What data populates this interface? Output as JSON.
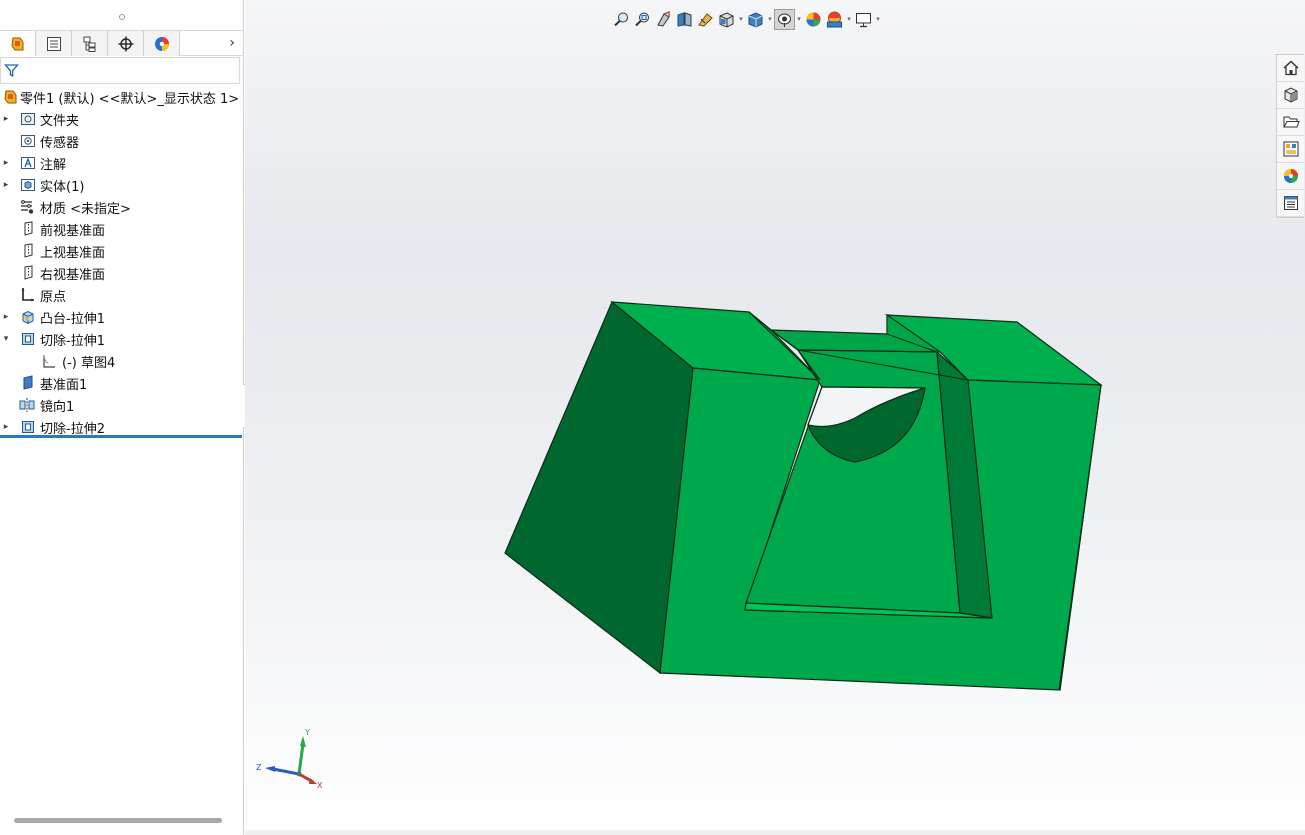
{
  "panel": {
    "tabs": [
      {
        "name": "featuremanager-tab",
        "icon": "featuremanager-icon"
      },
      {
        "name": "propertymanager-tab",
        "icon": "propertymanager-icon"
      },
      {
        "name": "configurationmanager-tab",
        "icon": "configurationmanager-icon"
      },
      {
        "name": "dimxpert-tab",
        "icon": "dimxpert-icon"
      },
      {
        "name": "displaymanager-tab",
        "icon": "displaymanager-icon"
      }
    ],
    "more_glyph": "›",
    "filter_icon": "filter-icon"
  },
  "tree": {
    "root": "零件1 (默认) <<默认>_显示状态 1>",
    "items": [
      {
        "label": "文件夹",
        "icon": "folder-icon",
        "expandable": true
      },
      {
        "label": "传感器",
        "icon": "sensor-icon",
        "expandable": false
      },
      {
        "label": "注解",
        "icon": "annotation-icon",
        "expandable": true
      },
      {
        "label": "实体(1)",
        "icon": "solid-bodies-icon",
        "expandable": true
      },
      {
        "label": "材质 <未指定>",
        "icon": "material-icon",
        "expandable": false
      },
      {
        "label": "前视基准面",
        "icon": "plane-icon",
        "expandable": false
      },
      {
        "label": "上视基准面",
        "icon": "plane-icon",
        "expandable": false
      },
      {
        "label": "右视基准面",
        "icon": "plane-icon",
        "expandable": false
      },
      {
        "label": "原点",
        "icon": "origin-icon",
        "expandable": false
      },
      {
        "label": "凸台-拉伸1",
        "icon": "boss-extrude-icon",
        "expandable": true
      },
      {
        "label": "切除-拉伸1",
        "icon": "cut-extrude-icon",
        "expandable": true,
        "expanded": true
      },
      {
        "label": "(-) 草图4",
        "icon": "sketch-icon",
        "expandable": false,
        "child": true
      },
      {
        "label": "基准面1",
        "icon": "plane-solid-icon",
        "expandable": false
      },
      {
        "label": "镜向1",
        "icon": "mirror-icon",
        "expandable": false
      },
      {
        "label": "切除-拉伸2",
        "icon": "cut-extrude-icon",
        "expandable": true
      }
    ]
  },
  "headsup_toolbar": [
    {
      "name": "zoom-to-fit",
      "icon": "zoom-to-fit-icon"
    },
    {
      "name": "zoom-to-area",
      "icon": "zoom-to-area-icon"
    },
    {
      "name": "previous-view",
      "icon": "previous-view-icon"
    },
    {
      "name": "section-view",
      "icon": "section-view-icon"
    },
    {
      "name": "dynamic-annotation",
      "icon": "dynamic-annotation-icon"
    },
    {
      "name": "view-orientation",
      "icon": "view-orientation-icon",
      "caret": true
    },
    {
      "name": "display-style",
      "icon": "display-style-icon",
      "caret": true
    },
    {
      "name": "hide-show-items",
      "icon": "hide-show-items-icon",
      "caret": true,
      "active": true
    },
    {
      "name": "edit-appearance",
      "icon": "edit-appearance-icon"
    },
    {
      "name": "apply-scene",
      "icon": "apply-scene-icon",
      "caret": true
    },
    {
      "name": "view-settings",
      "icon": "view-settings-icon",
      "caret": true
    }
  ],
  "task_pane": [
    {
      "name": "solidworks-resources",
      "icon": "home-icon"
    },
    {
      "name": "design-library",
      "icon": "design-library-icon"
    },
    {
      "name": "file-explorer",
      "icon": "folder-open-icon"
    },
    {
      "name": "view-palette",
      "icon": "view-palette-icon"
    },
    {
      "name": "appearances-scenes",
      "icon": "appearances-icon"
    },
    {
      "name": "custom-properties",
      "icon": "custom-properties-icon"
    }
  ],
  "triad": {
    "x_label": "X",
    "y_label": "Y",
    "z_label": "Z"
  },
  "colors": {
    "model_green": "#00b050",
    "model_dark": "#006b32",
    "selection_blue": "#2b79c2"
  }
}
